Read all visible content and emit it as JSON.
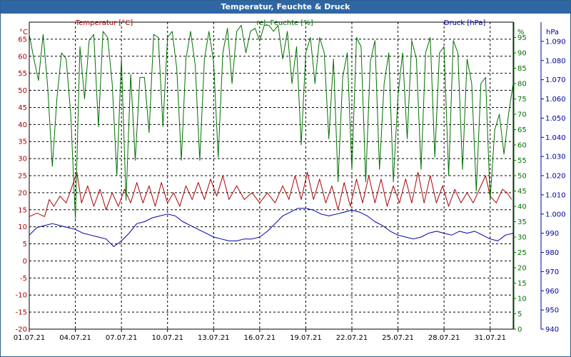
{
  "window": {
    "title": "Temperatur, Feuchte & Druck"
  },
  "chart_data": {
    "type": "line",
    "title": "Temperatur, Feuchte & Druck",
    "x_ticks": [
      "01.07.21",
      "04.07.21",
      "07.07.21",
      "10.07.21",
      "13.07.21",
      "16.07.21",
      "19.07.21",
      "22.07.21",
      "25.07.21",
      "28.07.21",
      "31.07.21"
    ],
    "x_range_days": [
      1,
      32.5
    ],
    "grid": true,
    "axes": {
      "temperature": {
        "label": "Temperatur [°C]",
        "unit": "°C",
        "min": -20,
        "max": 70,
        "ticks": [
          -20,
          -15,
          -10,
          -5,
          0,
          5,
          10,
          15,
          20,
          25,
          30,
          35,
          40,
          45,
          50,
          55,
          60,
          65
        ],
        "color": "#b00000"
      },
      "humidity": {
        "label": "rel. Feuchte [%]",
        "unit": "%",
        "min": 0,
        "max": 100,
        "ticks": [
          0,
          5,
          10,
          15,
          20,
          25,
          30,
          35,
          40,
          45,
          50,
          55,
          60,
          65,
          70,
          75,
          80,
          85,
          90,
          95
        ],
        "color": "#007000"
      },
      "pressure": {
        "label": "Druck [hPa]",
        "unit": "hPa",
        "min": 940,
        "max": 1100,
        "ticks": [
          "940",
          "950",
          "960",
          "970",
          "980",
          "990",
          "1.000",
          "1.010",
          "1.020",
          "1.030",
          "1.040",
          "1.050",
          "1.060",
          "1.070",
          "1.080",
          "1.090"
        ],
        "color": "#0000a0"
      }
    },
    "series": [
      {
        "name": "Temperatur [°C]",
        "axis": "temperature",
        "color": "#b00000",
        "points": [
          [
            1.0,
            13
          ],
          [
            1.5,
            14
          ],
          [
            2.0,
            13
          ],
          [
            2.3,
            18
          ],
          [
            2.6,
            16
          ],
          [
            3.0,
            19
          ],
          [
            3.4,
            17
          ],
          [
            3.8,
            22
          ],
          [
            4.1,
            26
          ],
          [
            4.4,
            17
          ],
          [
            4.8,
            22
          ],
          [
            5.2,
            16
          ],
          [
            5.6,
            21
          ],
          [
            6.0,
            15
          ],
          [
            6.4,
            20
          ],
          [
            6.8,
            16
          ],
          [
            7.2,
            21
          ],
          [
            7.6,
            17
          ],
          [
            8.0,
            23
          ],
          [
            8.4,
            17
          ],
          [
            8.8,
            22
          ],
          [
            9.2,
            16
          ],
          [
            9.6,
            23
          ],
          [
            10.0,
            17
          ],
          [
            10.4,
            20
          ],
          [
            10.8,
            16
          ],
          [
            11.2,
            22
          ],
          [
            11.6,
            18
          ],
          [
            12.0,
            23
          ],
          [
            12.4,
            18
          ],
          [
            12.8,
            24
          ],
          [
            13.2,
            19
          ],
          [
            13.6,
            25
          ],
          [
            14.0,
            18
          ],
          [
            14.5,
            22
          ],
          [
            15.0,
            18
          ],
          [
            15.5,
            20
          ],
          [
            16.0,
            17
          ],
          [
            16.5,
            20
          ],
          [
            17.0,
            17
          ],
          [
            17.5,
            22
          ],
          [
            17.9,
            18
          ],
          [
            18.3,
            25
          ],
          [
            18.7,
            18
          ],
          [
            19.1,
            26
          ],
          [
            19.5,
            18
          ],
          [
            19.9,
            24
          ],
          [
            20.3,
            17
          ],
          [
            20.7,
            22
          ],
          [
            21.1,
            15
          ],
          [
            21.5,
            23
          ],
          [
            21.9,
            16
          ],
          [
            22.3,
            24
          ],
          [
            22.7,
            17
          ],
          [
            23.1,
            25
          ],
          [
            23.5,
            17
          ],
          [
            23.9,
            24
          ],
          [
            24.3,
            16
          ],
          [
            24.7,
            22
          ],
          [
            25.1,
            17
          ],
          [
            25.5,
            24
          ],
          [
            25.9,
            17
          ],
          [
            26.3,
            26
          ],
          [
            26.7,
            17
          ],
          [
            27.1,
            25
          ],
          [
            27.5,
            17
          ],
          [
            27.9,
            22
          ],
          [
            28.3,
            16
          ],
          [
            28.7,
            21
          ],
          [
            29.1,
            17
          ],
          [
            29.5,
            20
          ],
          [
            29.9,
            17
          ],
          [
            30.3,
            21
          ],
          [
            30.7,
            25
          ],
          [
            31.0,
            19
          ],
          [
            31.4,
            17
          ],
          [
            31.8,
            21
          ],
          [
            32.1,
            20
          ],
          [
            32.4,
            18
          ]
        ]
      },
      {
        "name": "rel. Feuchte [%]",
        "axis": "humidity",
        "color": "#007000",
        "points": [
          [
            1.0,
            96
          ],
          [
            1.3,
            88
          ],
          [
            1.6,
            81
          ],
          [
            1.9,
            96
          ],
          [
            2.2,
            79
          ],
          [
            2.5,
            53
          ],
          [
            2.8,
            75
          ],
          [
            3.1,
            90
          ],
          [
            3.4,
            88
          ],
          [
            3.7,
            70
          ],
          [
            4.0,
            36
          ],
          [
            4.3,
            92
          ],
          [
            4.6,
            75
          ],
          [
            4.9,
            94
          ],
          [
            5.2,
            96
          ],
          [
            5.5,
            66
          ],
          [
            5.8,
            97
          ],
          [
            6.1,
            95
          ],
          [
            6.4,
            80
          ],
          [
            6.7,
            50
          ],
          [
            7.0,
            88
          ],
          [
            7.3,
            42
          ],
          [
            7.6,
            83
          ],
          [
            7.9,
            55
          ],
          [
            8.2,
            82
          ],
          [
            8.5,
            82
          ],
          [
            8.8,
            64
          ],
          [
            9.1,
            96
          ],
          [
            9.4,
            95
          ],
          [
            9.7,
            66
          ],
          [
            10.0,
            95
          ],
          [
            10.3,
            97
          ],
          [
            10.6,
            85
          ],
          [
            10.9,
            55
          ],
          [
            11.2,
            88
          ],
          [
            11.5,
            97
          ],
          [
            11.8,
            86
          ],
          [
            12.1,
            55
          ],
          [
            12.4,
            88
          ],
          [
            12.7,
            97
          ],
          [
            13.0,
            87
          ],
          [
            13.3,
            56
          ],
          [
            13.6,
            90
          ],
          [
            13.9,
            98
          ],
          [
            14.2,
            80
          ],
          [
            14.5,
            97
          ],
          [
            14.8,
            99
          ],
          [
            15.1,
            90
          ],
          [
            15.4,
            97
          ],
          [
            15.7,
            98
          ],
          [
            16.0,
            94
          ],
          [
            16.3,
            99
          ],
          [
            16.6,
            99
          ],
          [
            16.9,
            97
          ],
          [
            17.2,
            99
          ],
          [
            17.5,
            88
          ],
          [
            17.8,
            97
          ],
          [
            18.1,
            80
          ],
          [
            18.4,
            92
          ],
          [
            18.7,
            60
          ],
          [
            19.0,
            90
          ],
          [
            19.3,
            95
          ],
          [
            19.6,
            80
          ],
          [
            19.9,
            95
          ],
          [
            20.2,
            90
          ],
          [
            20.5,
            62
          ],
          [
            20.8,
            88
          ],
          [
            21.1,
            48
          ],
          [
            21.4,
            82
          ],
          [
            21.7,
            90
          ],
          [
            22.0,
            52
          ],
          [
            22.3,
            95
          ],
          [
            22.6,
            92
          ],
          [
            22.9,
            48
          ],
          [
            23.2,
            87
          ],
          [
            23.5,
            94
          ],
          [
            23.8,
            52
          ],
          [
            24.1,
            80
          ],
          [
            24.4,
            90
          ],
          [
            24.7,
            48
          ],
          [
            25.0,
            76
          ],
          [
            25.3,
            90
          ],
          [
            25.6,
            62
          ],
          [
            25.9,
            94
          ],
          [
            26.2,
            88
          ],
          [
            26.5,
            52
          ],
          [
            26.8,
            90
          ],
          [
            27.1,
            95
          ],
          [
            27.4,
            56
          ],
          [
            27.7,
            90
          ],
          [
            28.0,
            92
          ],
          [
            28.3,
            50
          ],
          [
            28.6,
            94
          ],
          [
            28.9,
            90
          ],
          [
            29.2,
            52
          ],
          [
            29.5,
            88
          ],
          [
            29.8,
            80
          ],
          [
            30.1,
            45
          ],
          [
            30.4,
            80
          ],
          [
            30.7,
            82
          ],
          [
            31.0,
            42
          ],
          [
            31.3,
            65
          ],
          [
            31.6,
            70
          ],
          [
            31.9,
            57
          ],
          [
            32.2,
            70
          ],
          [
            32.5,
            80
          ]
        ]
      },
      {
        "name": "Druck [hPa]",
        "axis": "pressure",
        "color": "#0000a0",
        "points": [
          [
            1.0,
            989
          ],
          [
            1.5,
            993
          ],
          [
            2.0,
            994
          ],
          [
            2.5,
            995
          ],
          [
            3.0,
            994
          ],
          [
            3.5,
            993
          ],
          [
            4.0,
            992
          ],
          [
            4.5,
            990
          ],
          [
            5.0,
            989
          ],
          [
            5.5,
            988
          ],
          [
            6.0,
            987
          ],
          [
            6.5,
            983
          ],
          [
            7.0,
            986
          ],
          [
            7.5,
            990
          ],
          [
            8.0,
            995
          ],
          [
            8.5,
            996
          ],
          [
            9.0,
            998
          ],
          [
            9.5,
            999
          ],
          [
            10.0,
            1000
          ],
          [
            10.5,
            999
          ],
          [
            11.0,
            996
          ],
          [
            11.5,
            994
          ],
          [
            12.0,
            992
          ],
          [
            12.5,
            990
          ],
          [
            13.0,
            988
          ],
          [
            13.5,
            987
          ],
          [
            14.0,
            986
          ],
          [
            14.5,
            986
          ],
          [
            15.0,
            987
          ],
          [
            15.5,
            987
          ],
          [
            16.0,
            988
          ],
          [
            16.5,
            991
          ],
          [
            17.0,
            995
          ],
          [
            17.5,
            999
          ],
          [
            18.0,
            1001
          ],
          [
            18.5,
            1003
          ],
          [
            19.0,
            1003
          ],
          [
            19.5,
            1002
          ],
          [
            20.0,
            1000
          ],
          [
            20.5,
            999
          ],
          [
            21.0,
            1000
          ],
          [
            21.5,
            1001
          ],
          [
            22.0,
            1002
          ],
          [
            22.5,
            1001
          ],
          [
            23.0,
            999
          ],
          [
            23.5,
            996
          ],
          [
            24.0,
            994
          ],
          [
            24.5,
            991
          ],
          [
            25.0,
            989
          ],
          [
            25.5,
            988
          ],
          [
            26.0,
            987
          ],
          [
            26.5,
            988
          ],
          [
            27.0,
            990
          ],
          [
            27.5,
            991
          ],
          [
            28.0,
            990
          ],
          [
            28.5,
            989
          ],
          [
            29.0,
            991
          ],
          [
            29.5,
            990
          ],
          [
            30.0,
            991
          ],
          [
            30.5,
            989
          ],
          [
            31.0,
            987
          ],
          [
            31.5,
            986
          ],
          [
            32.0,
            989
          ],
          [
            32.5,
            990
          ]
        ]
      }
    ]
  }
}
